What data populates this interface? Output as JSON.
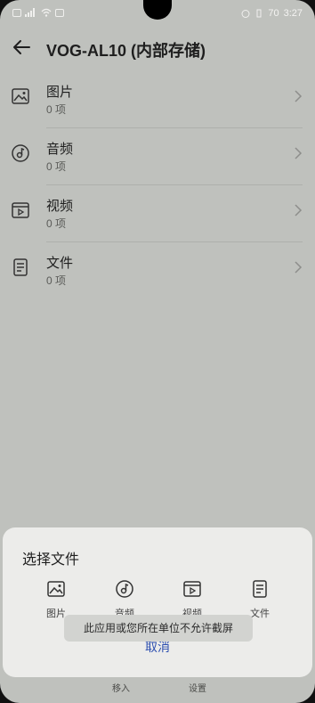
{
  "status": {
    "time": "3:27",
    "battery": "70"
  },
  "header": {
    "title": "VOG-AL10 (内部存储)"
  },
  "list": {
    "items": [
      {
        "label": "图片",
        "count": "0 项",
        "icon": "image-icon"
      },
      {
        "label": "音频",
        "count": "0 项",
        "icon": "music-icon"
      },
      {
        "label": "视频",
        "count": "0 项",
        "icon": "video-icon"
      },
      {
        "label": "文件",
        "count": "0 项",
        "icon": "document-icon"
      }
    ]
  },
  "sheet": {
    "title": "选择文件",
    "options": [
      {
        "label": "图片",
        "icon": "image-icon"
      },
      {
        "label": "音频",
        "icon": "music-icon"
      },
      {
        "label": "视频",
        "icon": "video-icon"
      },
      {
        "label": "文件",
        "icon": "document-icon"
      }
    ],
    "cancel": "取消"
  },
  "toast": {
    "text": "此应用或您所在单位不允许截屏"
  },
  "bottom_nav": {
    "items": [
      {
        "label": "移入",
        "icon": "move-in-icon"
      },
      {
        "label": "设置",
        "icon": "settings-icon"
      }
    ]
  }
}
